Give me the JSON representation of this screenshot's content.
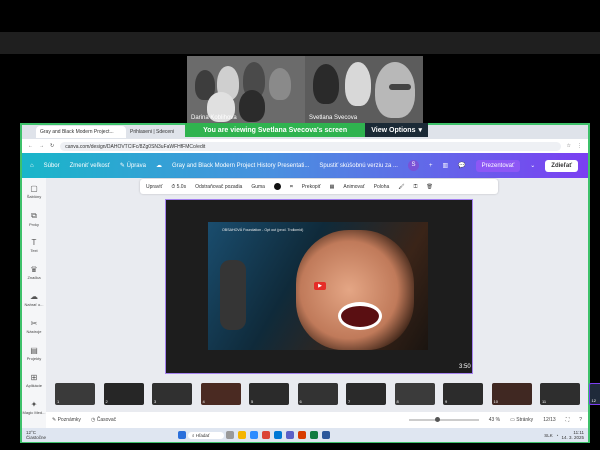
{
  "meeting": {
    "participants": [
      {
        "name": "Darina Koblihova"
      },
      {
        "name": "Svetlana Svecova"
      }
    ]
  },
  "share_banner": {
    "message": "You are viewing  Svetlana Svecova's screen",
    "view_options": "View Options"
  },
  "browser": {
    "tabs": [
      {
        "label": "Gray and Black Modern Project..."
      },
      {
        "label": "Prihlaseni | Sdeceni"
      }
    ],
    "url": "canva.com/design/DAHOVTCIFc/8Zg0SN3uFaWFHfFMCo/edit"
  },
  "canva_header": {
    "file": "Súbor",
    "resize": "Zmeniť veľkosť",
    "edit": "Úprava",
    "doc_title": "Gray and Black Modern Project History Presentati...",
    "slideshow": "Spustiť skúšobnú verziu za ...",
    "avatar": "S",
    "present": "Prezentovať",
    "share": "Zdieľať",
    "badge": "Nové"
  },
  "sidebar": {
    "items": [
      {
        "label": "Šablóny",
        "icon": "template-icon"
      },
      {
        "label": "Prvky",
        "icon": "elements-icon"
      },
      {
        "label": "Text",
        "icon": "text-icon"
      },
      {
        "label": "Značka",
        "icon": "brand-icon"
      },
      {
        "label": "Nahrať o...",
        "icon": "upload-icon"
      },
      {
        "label": "Nástroje",
        "icon": "tools-icon"
      },
      {
        "label": "Projekty",
        "icon": "projects-icon"
      },
      {
        "label": "Aplikácie",
        "icon": "apps-icon"
      },
      {
        "label": "Magic Med...",
        "icon": "magic-icon"
      }
    ]
  },
  "toolbar": {
    "edit": "Upraviť",
    "duration": "5.0s",
    "remove_bg": "Odstraňovač pozadia",
    "eraser": "Guma",
    "crop": "Prekopiť",
    "animate": "Animovať",
    "position": "Poloha"
  },
  "video": {
    "title": "OBSAHOVÁ Foundation - Opt out (prod. Trollomid)",
    "duration_label": "3:50"
  },
  "filmstrip": {
    "slides": [
      "1",
      "2",
      "3",
      "4",
      "5",
      "6",
      "7",
      "8",
      "9",
      "10",
      "11",
      "12",
      "13"
    ],
    "selected": 12
  },
  "bottom_bar": {
    "notes": "Poznámky",
    "timer": "Časovač",
    "zoom": "43 %",
    "pages": "Stránky",
    "page_count": "12/13"
  },
  "taskbar": {
    "weather": "12°C",
    "weather_desc": "Čiastočne",
    "search": "Hľadať",
    "lang": "SLK",
    "time": "11:11",
    "date": "14. 3. 2025"
  },
  "colors": {
    "accent": "#7b3ff2",
    "banner": "#2fb34f",
    "header_start": "#19b6c9"
  }
}
